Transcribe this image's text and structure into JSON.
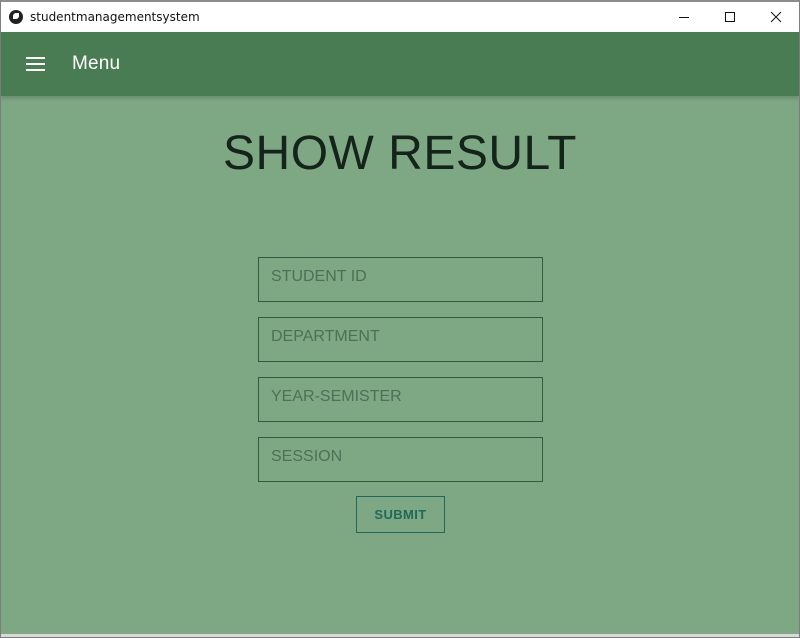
{
  "window": {
    "title": "studentmanagementsystem"
  },
  "toolbar": {
    "title": "Menu"
  },
  "page": {
    "heading": "SHOW RESULT"
  },
  "form": {
    "fields": [
      {
        "placeholder": "STUDENT ID",
        "value": ""
      },
      {
        "placeholder": "DEPARTMENT",
        "value": ""
      },
      {
        "placeholder": "YEAR-SEMISTER",
        "value": ""
      },
      {
        "placeholder": "SESSION",
        "value": ""
      }
    ],
    "submit_label": "SUBMIT"
  },
  "colors": {
    "background": "#7ea784",
    "toolbar": "#4a7c54",
    "submit_accent": "#1f6a5b"
  },
  "icons": {
    "app": "kivy-app-icon",
    "menu": "hamburger-menu-icon",
    "minimize": "minimize-icon",
    "maximize": "maximize-icon",
    "close": "close-icon"
  }
}
